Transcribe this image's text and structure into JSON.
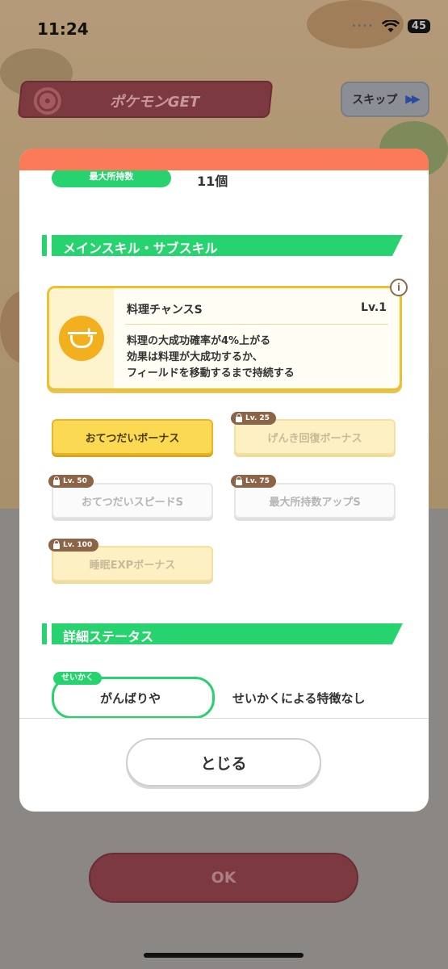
{
  "status_bar": {
    "time": "11:24",
    "battery": "45"
  },
  "header": {
    "title": "ポケモンGET",
    "skip_label": "スキップ"
  },
  "modal": {
    "max_capacity": {
      "label": "最大所持数",
      "value": "11個"
    },
    "skills_section_title": "メインスキル・サブスキル",
    "main_skill": {
      "name": "料理チャンスS",
      "level": "Lv.1",
      "description": [
        "料理の大成功確率が4%上がる",
        "効果は料理が大成功するか、",
        "フィールドを移動するまで持続する"
      ]
    },
    "sub_skills": [
      {
        "label": "おてつだいボーナス",
        "lock": ""
      },
      {
        "label": "げんき回復ボーナス",
        "lock": "Lv. 25"
      },
      {
        "label": "おてつだいスピードS",
        "lock": "Lv. 50"
      },
      {
        "label": "最大所持数アップS",
        "lock": "Lv. 75"
      },
      {
        "label": "睡眠EXPボーナス",
        "lock": "Lv. 100"
      }
    ],
    "details_section_title": "詳細ステータス",
    "nature": {
      "tag": "せいかく",
      "value": "がんばりや",
      "description": "せいかくによる特徴なし"
    },
    "close_label": "とじる"
  },
  "ok_label": "OK"
}
